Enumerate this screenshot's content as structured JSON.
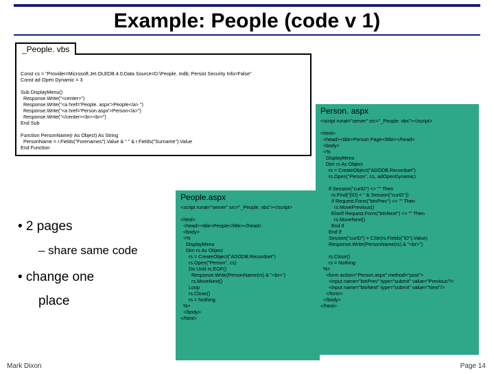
{
  "title": "Example: People (code v 1)",
  "vbs": {
    "filename": "_People. vbs",
    "code": "Const cs = \"Provider=Microsoft.Jet.OLEDB.4.0;Data Source=D:\\People. mdb; Persist Security Info=False\"\nConst ad Open Dynamic = 3\n\nSub DisplayMenu()\n  Response.Write(\"<center>\")\n  Response.Write(\"<a href='People. aspx'>People</a> \")\n  Response.Write(\"<a href='Person.aspx'>Person</a>\")\n  Response.Write(\"</center><br><br>\")\nEnd Sub\n\nFunction PersonName(r As Object) As String\n  PersonName = r.Fields(\"Forenames\").Value & \" \" & r.Fields(\"Surname\").Value\nEnd Function"
  },
  "people": {
    "title": "People.aspx",
    "code": "<script runat=\"server\" src=\"_People. vbs\"></script>\n\n<html>\n  <head><title>People</title></head>\n  <body>\n  <%\n    DisplayMenu\n    Dim rs As Object\n      rs = CreateObject(\"ADODB.Recordset\")\n      rs.Open(\"Person\", cs)\n      Do Until rs.EOF()\n        Response.Write(PersonName(rs) & \"<br>\")\n        rs.MoveNext()\n      Loop\n      rs.Close()\n      rs = Nothing\n  %>\n  </body>\n</html>"
  },
  "person": {
    "title": "Person. aspx",
    "code": "<script runat=\"server\" src=\"_People. vbs\"></script>\n\n<html>\n  <head><title>Person Page</title></head>\n  <body>\n  <%\n    DisplayMenu\n    Dim rs As Object\n      rs = CreateObject(\"ADODB.Recordset\")\n      rs.Open(\"Person\", cs, adOpenDynamic)\n\n      If Session(\"curID\") <> \"\" Then\n        rs.Find(\"[ID] = \" & Session(\"curID\"))\n        If Request.Form(\"btnPrev\") <> \"\" Then\n          rs.MovePrevious()\n        ElseIf Request.Form(\"btnNext\") <> \"\" Then\n          rs.MoveNext()\n        End If\n      End If\n      Session(\"curID\") = CStr(rs.Fields(\"ID\").Value)\n      Response.Write(PersonName(rs) & \"<br>\")\n\n      rs.Close()\n      rs = Nothing\n  %>\n    <form action=\"Person.aspx\" method=\"post\">\n      <input name=\"btnPrev\" type=\"submit\" value=\"Previous\"/>\n      <input name=\"btnNext\" type=\"submit\" value=\"Next\"/>\n    </form>\n  </body>\n</html>"
  },
  "bullets": {
    "b1": "• 2 pages",
    "b2": "– share same code",
    "b3": "• change one",
    "b4": "place"
  },
  "footer": {
    "left": "Mark Dixon",
    "right": "Page 14"
  }
}
